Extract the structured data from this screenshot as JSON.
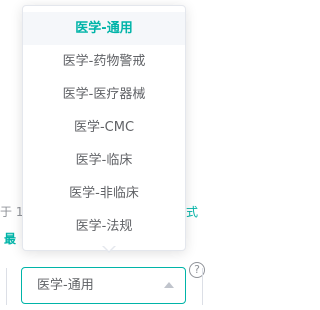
{
  "background": {
    "left_line_1": "于 1",
    "left_line_2": "最",
    "right_link": "式",
    "help_glyph": "?"
  },
  "dropdown": {
    "options": [
      {
        "label": "医学-通用",
        "selected": true
      },
      {
        "label": "医学-药物警戒",
        "selected": false
      },
      {
        "label": "医学-医疗器械",
        "selected": false
      },
      {
        "label": "医学-CMC",
        "selected": false
      },
      {
        "label": "医学-临床",
        "selected": false
      },
      {
        "label": "医学-非临床",
        "selected": false
      },
      {
        "label": "医学-法规",
        "selected": false
      }
    ]
  },
  "select": {
    "value": "医学-通用",
    "caret_icon": "caret-up-icon"
  },
  "colors": {
    "accent": "#00b4a8",
    "text": "#606266",
    "border": "#e4e7ed"
  }
}
